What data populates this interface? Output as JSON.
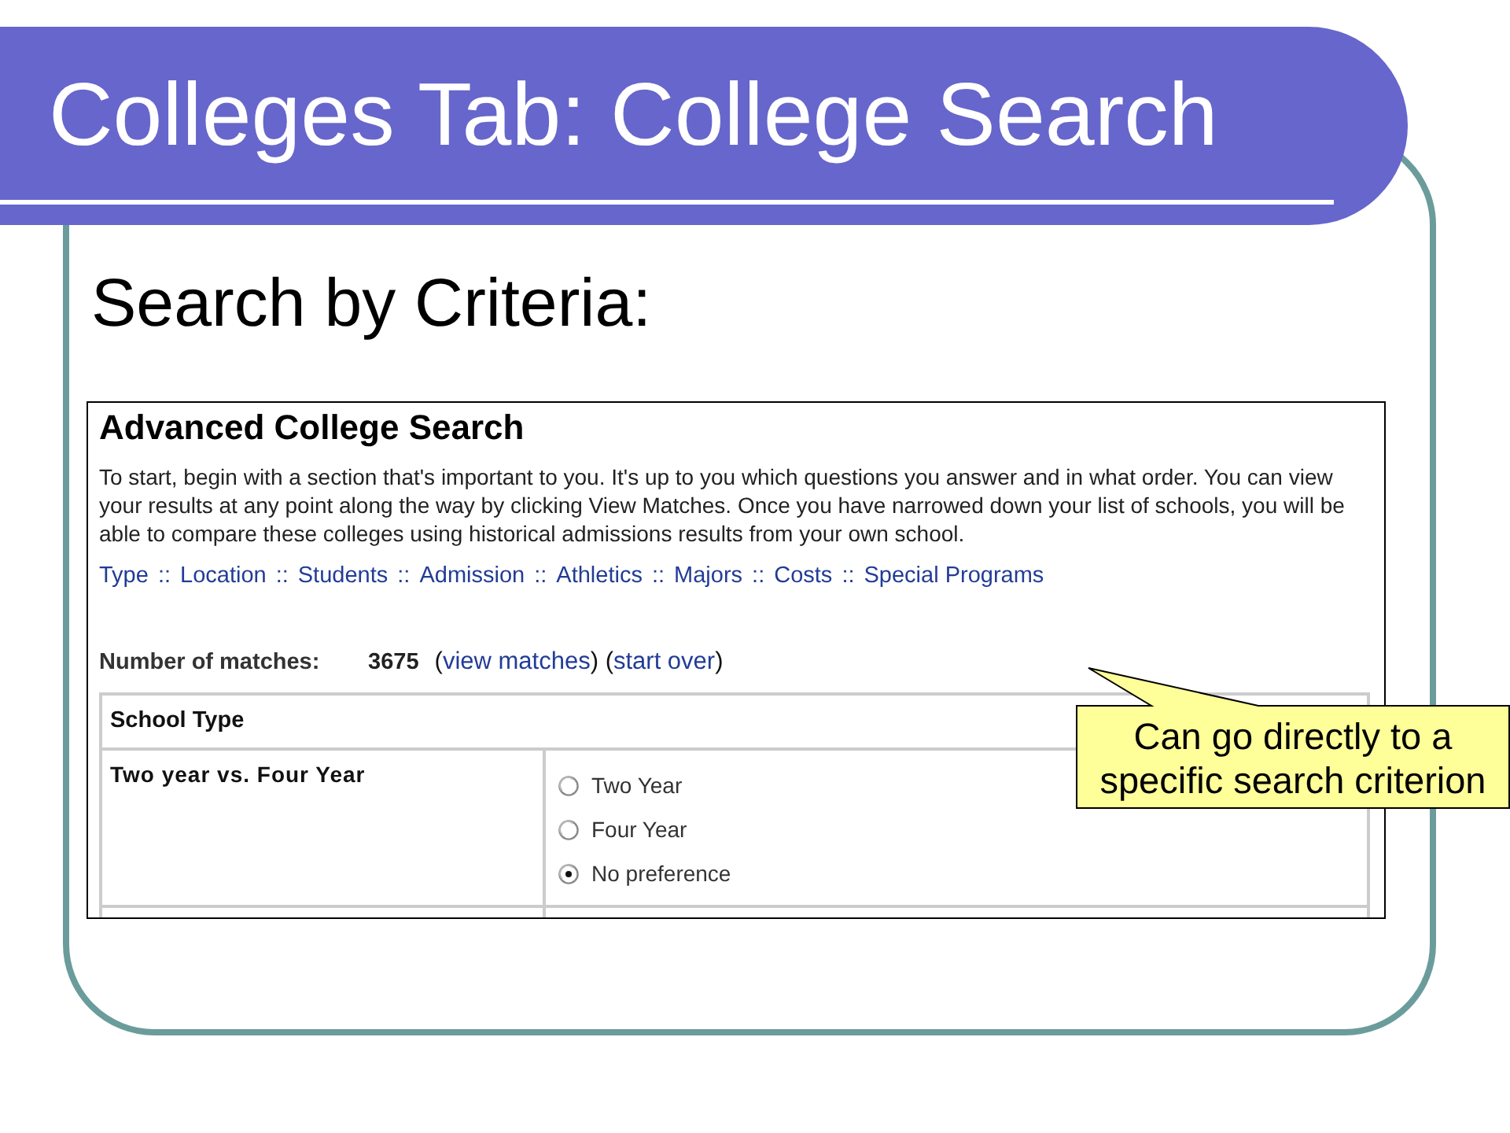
{
  "slide": {
    "title": "Colleges Tab: College Search",
    "subtitle": "Search by Criteria:"
  },
  "screenshot": {
    "heading": "Advanced College Search",
    "intro": "To start, begin with a section that's important to you. It's up to you which questions you answer and in what order. You can view your results at any point along the way by clicking View Matches. Once you have narrowed down your list of schools, you will be able to compare these colleges using historical admissions results from your own school.",
    "section_nav": {
      "separator": "::",
      "links": [
        "Type",
        "Location",
        "Students",
        "Admission",
        "Athletics",
        "Majors",
        "Costs",
        "Special Programs"
      ]
    },
    "matches": {
      "label": "Number of matches:",
      "count": "3675",
      "open": "(",
      "close": ")",
      "links": [
        "view matches",
        "start over"
      ]
    },
    "table": {
      "section": "School Type",
      "rows": [
        {
          "question": "Two year vs. Four Year",
          "options": [
            {
              "label": "Two Year",
              "selected": false
            },
            {
              "label": "Four Year",
              "selected": false
            },
            {
              "label": "No preference",
              "selected": true
            }
          ]
        }
      ]
    }
  },
  "callout": {
    "text": "Can go directly to a specific search criterion"
  }
}
